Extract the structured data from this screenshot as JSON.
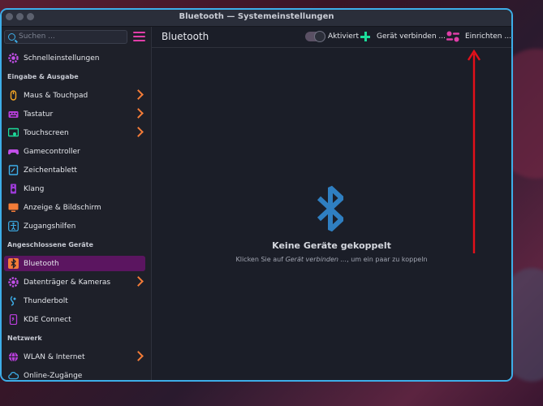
{
  "window": {
    "title": "Bluetooth — Systemeinstellungen"
  },
  "sidebar": {
    "search_placeholder": "Suchen ...",
    "top_item": {
      "label": "Schnelleinstellungen",
      "icon": "gear-icon"
    },
    "sections": [
      {
        "title": "Eingabe & Ausgabe",
        "items": [
          {
            "label": "Maus & Touchpad",
            "icon": "mouse-icon",
            "chevron": true
          },
          {
            "label": "Tastatur",
            "icon": "keyboard-icon",
            "chevron": true
          },
          {
            "label": "Touchscreen",
            "icon": "touchscreen-icon",
            "chevron": true
          },
          {
            "label": "Gamecontroller",
            "icon": "gamepad-icon",
            "chevron": false
          },
          {
            "label": "Zeichentablett",
            "icon": "tablet-icon",
            "chevron": false
          },
          {
            "label": "Klang",
            "icon": "speaker-icon",
            "chevron": false
          },
          {
            "label": "Anzeige & Bildschirm",
            "icon": "display-icon",
            "chevron": false
          },
          {
            "label": "Zugangshilfen",
            "icon": "accessibility-icon",
            "chevron": false
          }
        ]
      },
      {
        "title": "Angeschlossene Geräte",
        "items": [
          {
            "label": "Bluetooth",
            "icon": "bluetooth-icon",
            "chevron": false,
            "active": true
          },
          {
            "label": "Datenträger & Kameras",
            "icon": "drive-icon",
            "chevron": true
          },
          {
            "label": "Thunderbolt",
            "icon": "thunderbolt-icon",
            "chevron": false
          },
          {
            "label": "KDE Connect",
            "icon": "kdeconnect-icon",
            "chevron": false
          }
        ]
      },
      {
        "title": "Netzwerk",
        "items": [
          {
            "label": "WLAN & Internet",
            "icon": "globe-icon",
            "chevron": true
          },
          {
            "label": "Online-Zugänge",
            "icon": "cloud-icon",
            "chevron": false
          }
        ]
      }
    ]
  },
  "main": {
    "title": "Bluetooth",
    "toolbar": {
      "toggle_label": "Aktiviert",
      "toggle_on": true,
      "connect_label": "Gerät verbinden ...",
      "setup_label": "Einrichten ..."
    },
    "empty_state": {
      "title": "Keine Geräte gekoppelt",
      "hint_prefix": "Klicken Sie auf ",
      "hint_emph": "Gerät verbinden ...",
      "hint_suffix": ", um ein paar zu koppeln"
    }
  },
  "colors": {
    "accent": "#3daee9",
    "active_item": "#5b1560",
    "chevron": "#f47c38",
    "add": "#1cdc9a",
    "annotation_arrow": "#e3101a"
  }
}
